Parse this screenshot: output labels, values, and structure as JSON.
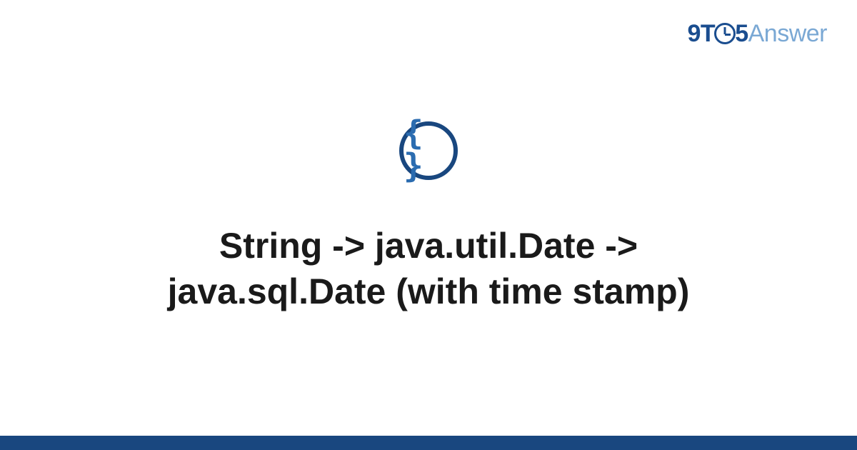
{
  "logo": {
    "part1": "9T",
    "part2": "5",
    "part3": "Answer"
  },
  "icon": {
    "braces": "{ }"
  },
  "title": "String -> java.util.Date -> java.sql.Date (with time stamp)",
  "colors": {
    "brand_primary": "#19477f",
    "brand_secondary": "#2b6cb0",
    "brand_light": "#7aa8d4"
  }
}
